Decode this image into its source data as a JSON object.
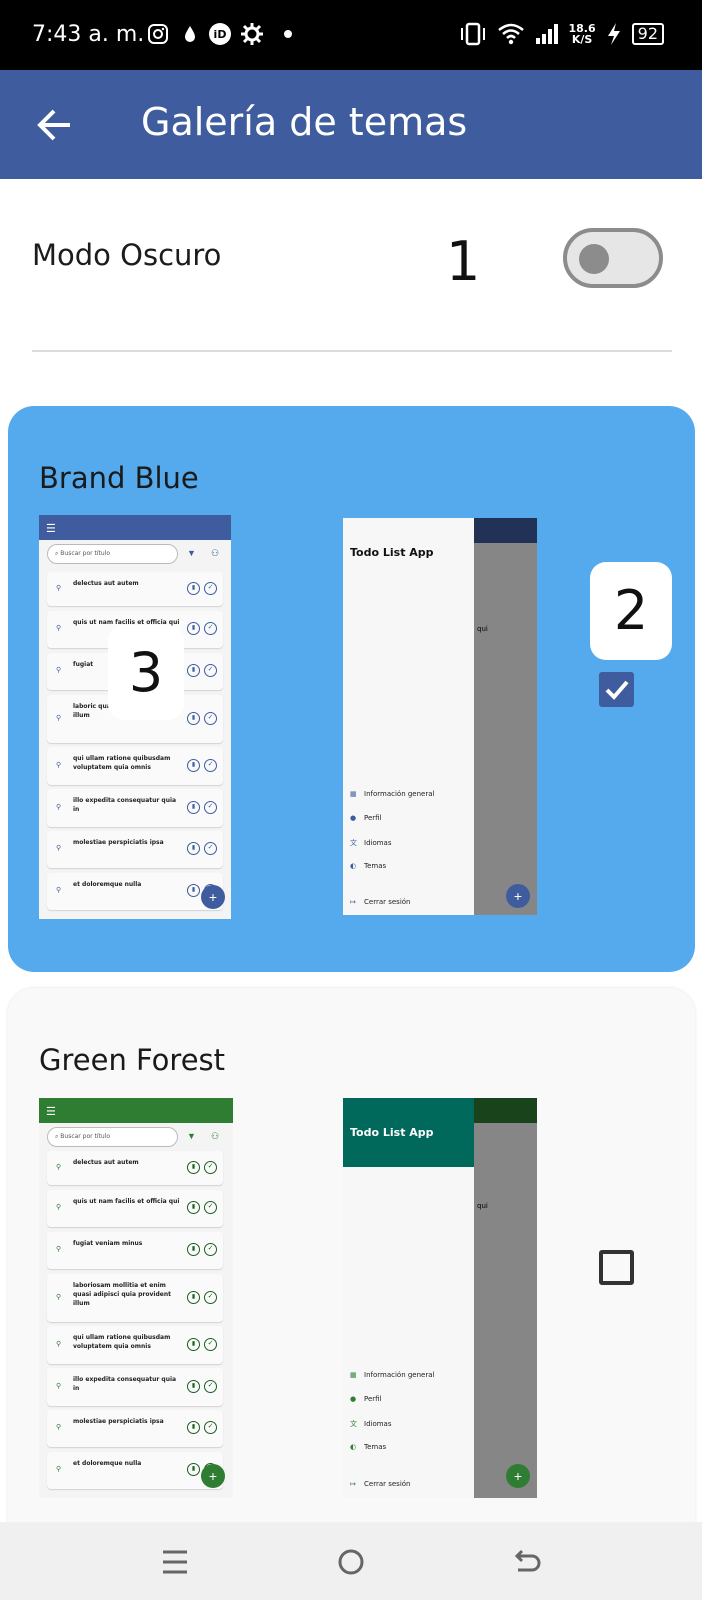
{
  "status_bar": {
    "time": "7:43 a. m.",
    "net_speed_value": "18.6",
    "net_speed_unit": "K/S",
    "battery": "92",
    "icons": [
      "instagram-icon",
      "drop-icon",
      "id-icon",
      "gear-icon",
      "dot-icon",
      "vibrate-icon",
      "wifi-icon",
      "signal-icon",
      "bolt-icon"
    ]
  },
  "app_bar": {
    "title": "Galería de temas",
    "back_icon": "arrow-left-icon"
  },
  "dark_mode": {
    "label": "Modo Oscuro",
    "enabled": false
  },
  "badges": [
    "1",
    "2",
    "3"
  ],
  "themes": [
    {
      "name": "Brand Blue",
      "selected": true,
      "primary": "#3e5c9e",
      "card_bg": "#55aaee",
      "drawer_header": "#f7f7f7"
    },
    {
      "name": "Green Forest",
      "selected": false,
      "primary": "#2e7d32",
      "card_bg": "#f9f9f9",
      "drawer_header": "#00695c"
    }
  ],
  "preview": {
    "search_placeholder": "Buscar por título",
    "items": [
      "delectus aut autem",
      "quis ut nam facilis et officia qui",
      "fugiat veniam minus",
      "laboriosam mollitia et enim quasi adipisci quia provident illum",
      "qui ullam ratione quibusdam voluptatem quia omnis",
      "illo expedita consequatur quia in",
      "molestiae perspiciatis ipsa",
      "et doloremque nulla"
    ],
    "blue_visible_items": [
      "delectus aut autem",
      "quis ut nam facilis et officia qui",
      "fugiat",
      "laboric quasi a illum",
      "qui ullam ratione quibusdam voluptatem quia omnis",
      "illo expedita consequatur quia in",
      "molestiae perspiciatis ipsa",
      "et doloremque nulla"
    ],
    "drawer_title": "Todo List App",
    "drawer_nav": [
      "Información general",
      "Perfil",
      "Idiomas",
      "Temas"
    ],
    "logout": "Cerrar sesión",
    "hidden_item_fragment": "qui"
  },
  "nav_bar": {
    "buttons": [
      "menu-icon",
      "home-circle-icon",
      "back-icon"
    ]
  }
}
